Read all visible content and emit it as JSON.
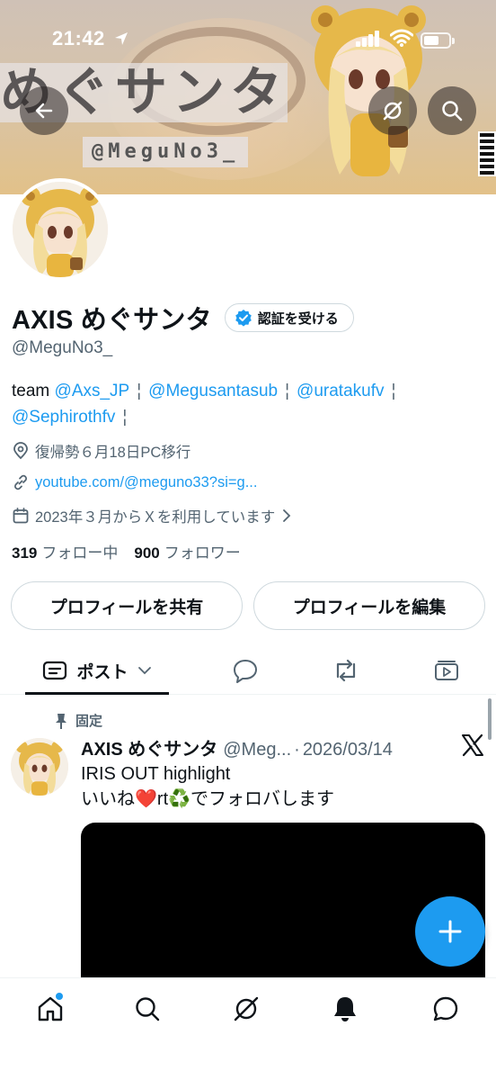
{
  "status_bar": {
    "time": "21:42"
  },
  "banner": {
    "title": "めぐサンタ",
    "handle": "@MeguNo3_"
  },
  "profile": {
    "display_name": "AXIS めぐサンタ",
    "verify_label": "認証を受ける",
    "handle": "@MeguNo3_",
    "bio": {
      "prefix": "team",
      "mentions": [
        "@Axs_JP",
        "@Megusantasub",
        "@uratakufv",
        "@Sephirothfv"
      ],
      "separator": "¦"
    },
    "location": "復帰勢６月18日PC移行",
    "link": "youtube.com/@meguno33?si=g...",
    "joined": "2023年３月からＸを利用しています",
    "following_count": "319",
    "following_label": "フォロー中",
    "followers_count": "900",
    "followers_label": "フォロワー"
  },
  "actions": {
    "share_label": "プロフィールを共有",
    "edit_label": "プロフィールを編集"
  },
  "tabs": {
    "posts_label": "ポスト"
  },
  "post": {
    "pinned_label": "固定",
    "author_name": "AXIS めぐサンタ",
    "author_handle": "@Meg...",
    "separator": "·",
    "date": "2026/03/14",
    "line1": "IRIS OUT highlight",
    "line2_a": "いいね",
    "line2_b": "rt",
    "line2_c": "でフォロバします",
    "emoji_heart": "❤️",
    "emoji_recycle": "♻️"
  },
  "colors": {
    "accent": "#1d9bf0",
    "text": "#0f1419",
    "secondary": "#536471",
    "border": "#cfd9de"
  },
  "icons": {
    "back": "arrow-left-icon",
    "grok": "grok-icon",
    "search": "search-icon",
    "verified": "verified-badge-icon",
    "location": "location-pin-icon",
    "link": "link-icon",
    "calendar": "calendar-icon",
    "pin": "pin-icon",
    "x_logo": "x-logo-icon",
    "compose": "plus-icon",
    "home": "home-icon",
    "notifications": "bell-icon",
    "messages": "message-icon"
  }
}
